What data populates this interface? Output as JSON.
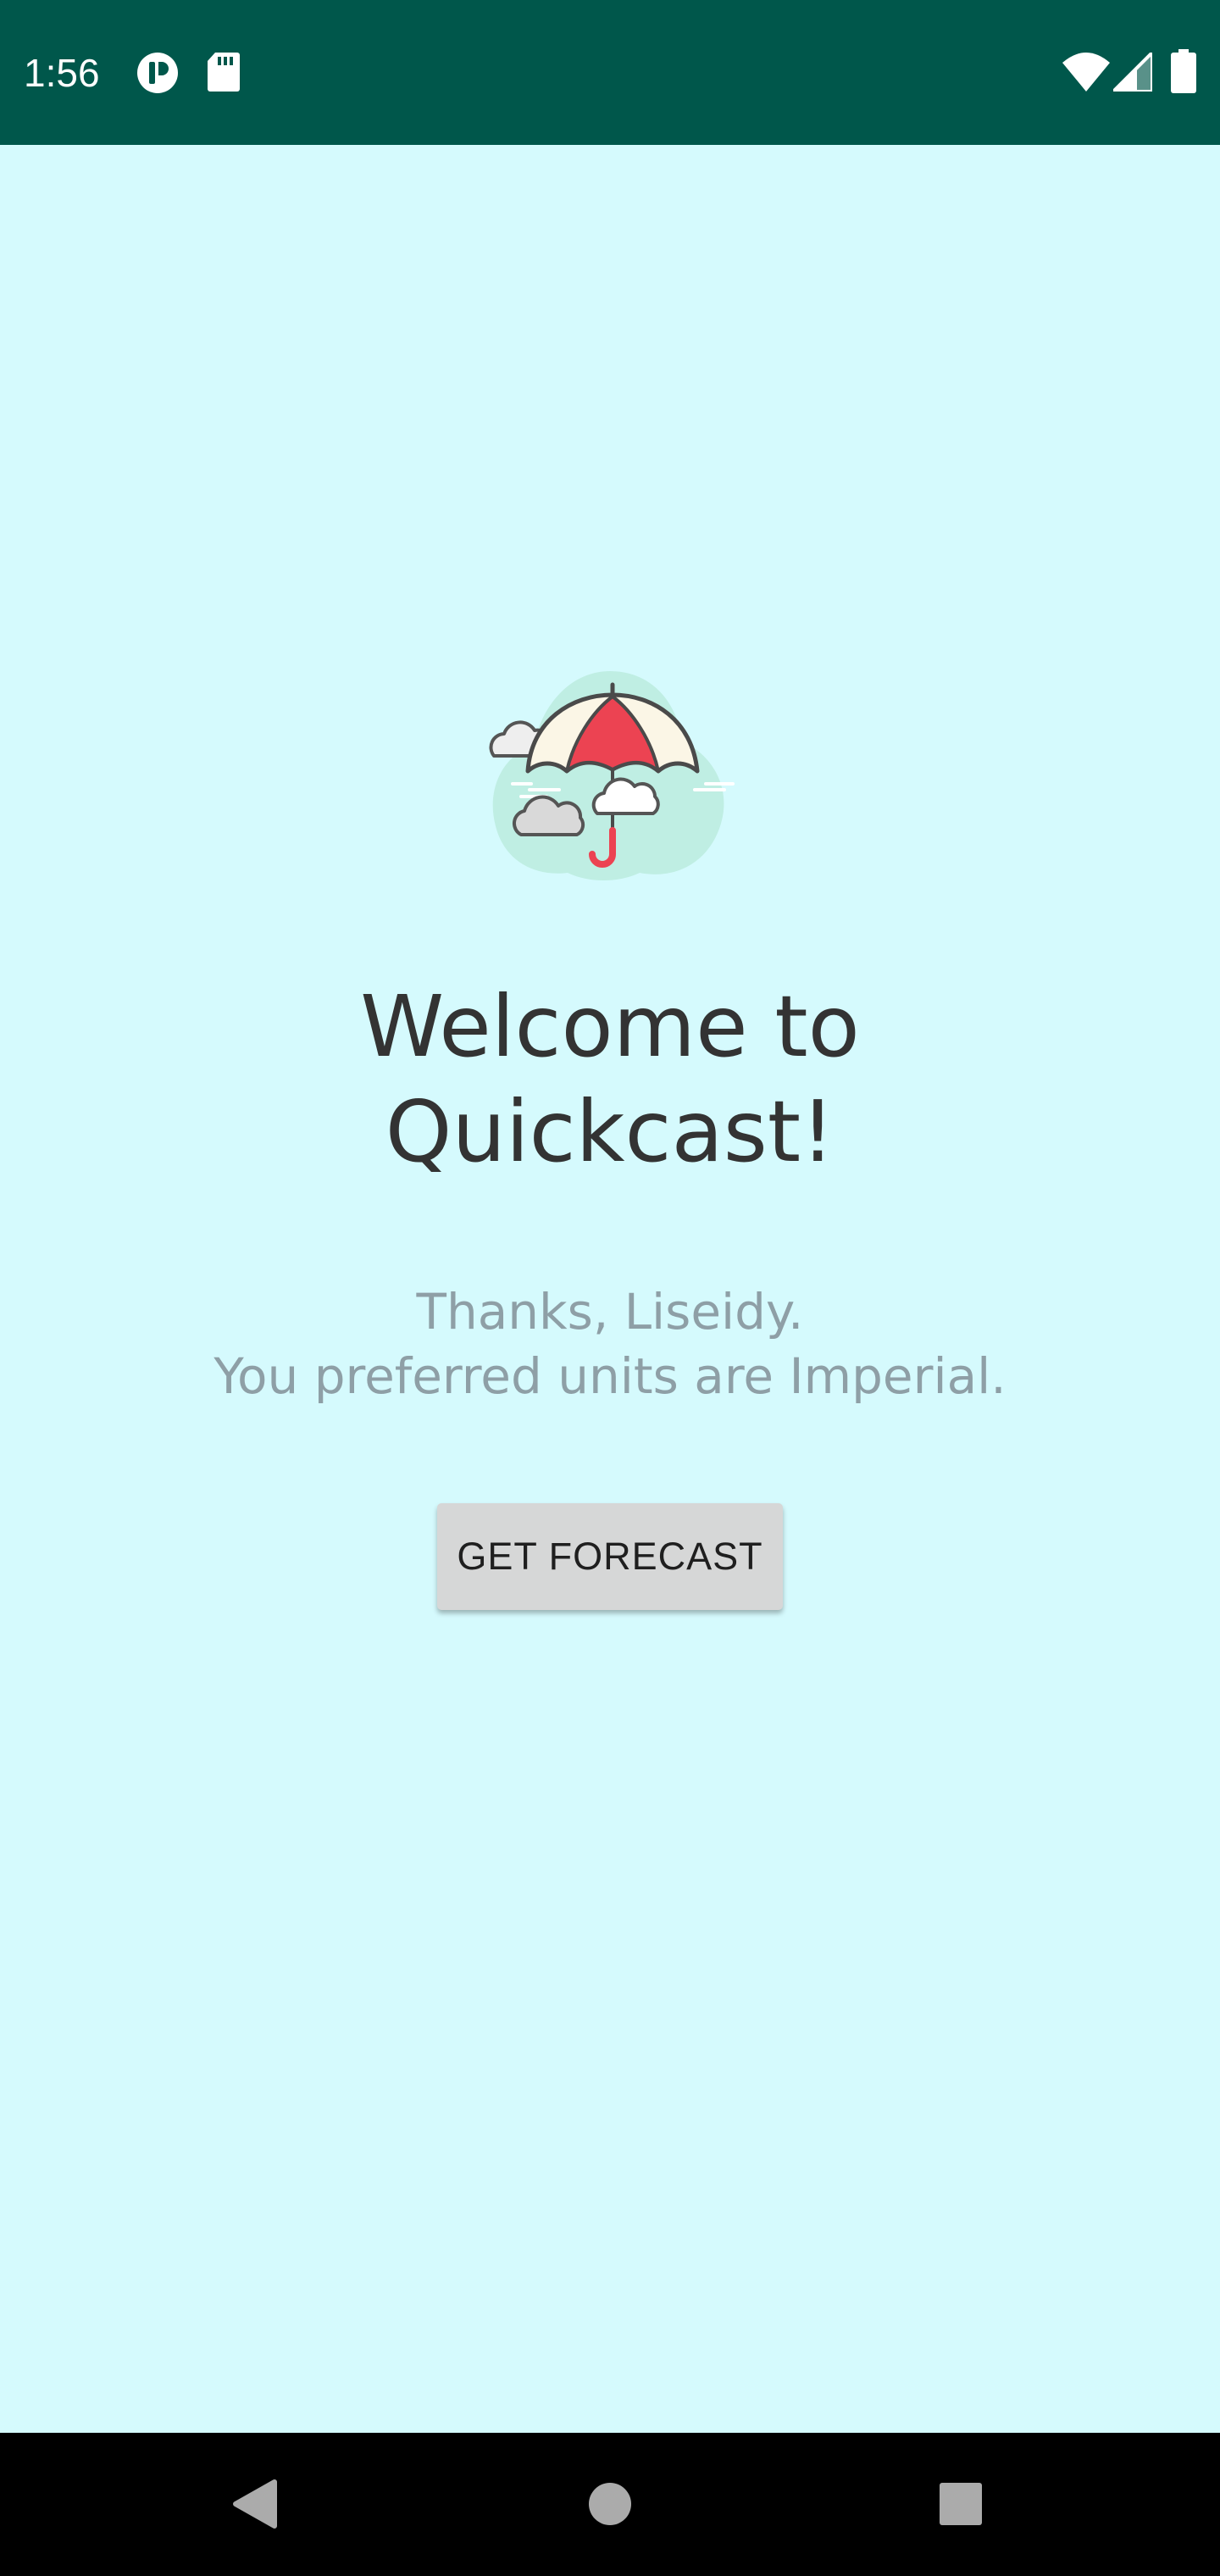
{
  "status_bar": {
    "time": "1:56",
    "left_icons": [
      "app-notification-icon",
      "sd-card-icon"
    ],
    "right_icons": [
      "wifi-icon",
      "cell-signal-icon",
      "battery-icon"
    ],
    "background_color": "#00574b"
  },
  "main": {
    "background_color": "#d5fafd",
    "logo_icon": "umbrella-clouds-icon",
    "title_line1": "Welcome to",
    "title_line2": "Quickcast!",
    "subtitle_line1": "Thanks, Liseidy.",
    "subtitle_line2": "You preferred units are Imperial.",
    "forecast_button_label": "GET FORECAST"
  },
  "nav_bar": {
    "buttons": [
      "back-icon",
      "home-icon",
      "recents-icon"
    ]
  }
}
